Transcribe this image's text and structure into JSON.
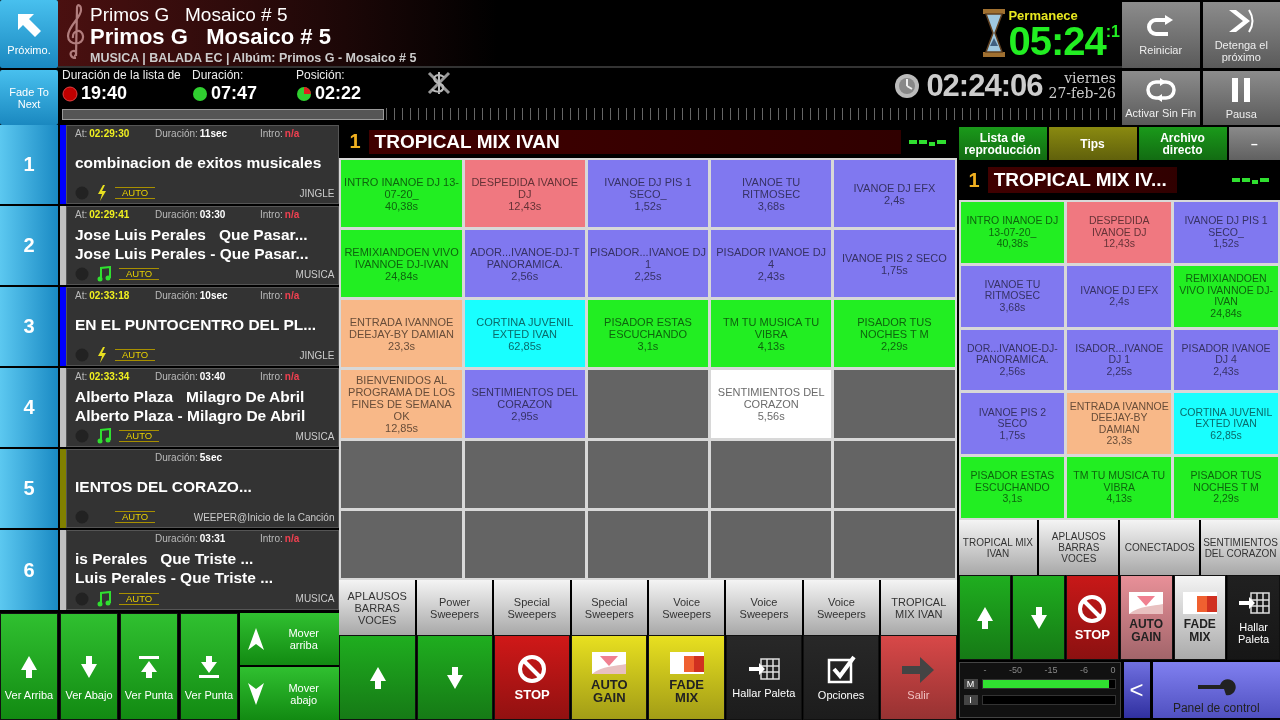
{
  "top": {
    "next_button": "Próximo.",
    "fade_button": "Fade To Next",
    "now_playing": {
      "title_small": "Primos G   Mosaico # 5",
      "title": "Primos G   Mosaico # 5",
      "info": "MUSICA | BALADA EC | Albúm: Primos G - Mosaico # 5"
    },
    "timers": [
      {
        "label": "Duración de la lista de",
        "value": "19:40",
        "kind": "list"
      },
      {
        "label": "Duración:",
        "value": "07:47",
        "kind": "track"
      },
      {
        "label": "Posición:",
        "value": "02:22",
        "kind": "position"
      }
    ],
    "remaining": {
      "label": "Permanece",
      "value": "05:24",
      "fraction": ":1"
    },
    "clock": {
      "time": "02:24:06",
      "day": "viernes",
      "date": "27-feb-26"
    },
    "controls": [
      {
        "kind": "restart",
        "label": "Reiniciar"
      },
      {
        "kind": "skip",
        "label": "Detenga el próximo"
      },
      {
        "kind": "loop",
        "label": "Activar Sin Fin"
      },
      {
        "kind": "pause",
        "label": "Pausa"
      }
    ]
  },
  "playlist": [
    {
      "number": "1",
      "at_label": "At:",
      "at": "02:29:30",
      "duration_label": "Duración:",
      "duration": "11sec",
      "intro_label": "Intro:",
      "intro": "n/a",
      "lines": [
        "combinacion de exitos musicales"
      ],
      "kind": "jingle",
      "mode": "AUTO",
      "type": "JINGLE",
      "color": "#0000ff"
    },
    {
      "number": "2",
      "at_label": "At:",
      "at": "02:29:41",
      "duration_label": "Duración:",
      "duration": "03:30",
      "intro_label": "Intro:",
      "intro": "n/a",
      "lines": [
        "Jose Luis Perales   Que Pasar...",
        "Jose Luis Perales - Que Pasar..."
      ],
      "kind": "music",
      "mode": "AUTO",
      "type": "MUSICA",
      "color": "#c0c0c0"
    },
    {
      "number": "3",
      "at_label": "At:",
      "at": "02:33:18",
      "duration_label": "Duración:",
      "duration": "10sec",
      "intro_label": "Intro:",
      "intro": "n/a",
      "lines": [
        "EN EL PUNTOCENTRO DEL PL..."
      ],
      "kind": "jingle",
      "mode": "AUTO",
      "type": "JINGLE",
      "color": "#0000ff"
    },
    {
      "number": "4",
      "at_label": "At:",
      "at": "02:33:34",
      "duration_label": "Duración:",
      "duration": "03:40",
      "intro_label": "Intro:",
      "intro": "n/a",
      "lines": [
        "Alberto Plaza   Milagro De Abril",
        "Alberto Plaza - Milagro De Abril"
      ],
      "kind": "music",
      "mode": "AUTO",
      "type": "MUSICA",
      "color": "#c0c0c0"
    },
    {
      "number": "5",
      "duration_label": "Duración:",
      "duration": "5sec",
      "lines": [
        "IENTOS DEL CORAZO..."
      ],
      "mode": "AUTO",
      "type": "WEEPER@Inicio de la Canción",
      "color": "#808000"
    },
    {
      "number": "6",
      "duration_label": "Duración:",
      "duration": "03:31",
      "intro_label": "Intro:",
      "intro": "n/a",
      "lines": [
        "is Perales   Que Triste ...",
        "Luis Perales - Que Triste ..."
      ],
      "kind": "music",
      "mode": "AUTO",
      "type": "MUSICA",
      "color": "#c0c0c0"
    }
  ],
  "center": {
    "page_number": "1",
    "title": "TROPICAL MIX IVAN",
    "cells": [
      {
        "name": "INTRO INANOE DJ 13-07-20_",
        "duration": "40,38s",
        "color": "#22ee22"
      },
      {
        "name": "DESPEDIDA IVANOE DJ",
        "duration": "12,43s",
        "color": "#f07880"
      },
      {
        "name": "IVANOE DJ PIS 1 SECO_",
        "duration": "1,52s",
        "color": "#8078f0"
      },
      {
        "name": "IVANOE TU RITMOSEC",
        "duration": "3,68s",
        "color": "#8078f0"
      },
      {
        "name": "IVANOE DJ EFX",
        "duration": "2,4s",
        "color": "#8078f0"
      },
      {
        "name": "REMIXIANDOEN VIVO IVANNOE DJ-IVAN",
        "duration": "24,84s",
        "color": "#22ee22"
      },
      {
        "name": "ADOR...IVANOE-DJ-T PANORAMICA.",
        "duration": "2,56s",
        "color": "#8078f0"
      },
      {
        "name": "PISADOR...IVANOE DJ  1",
        "duration": "2,25s",
        "color": "#8078f0"
      },
      {
        "name": "PISADOR IVANOE DJ 4",
        "duration": "2,43s",
        "color": "#8078f0"
      },
      {
        "name": "IVANOE PIS 2 SECO",
        "duration": "1,75s",
        "color": "#8078f0"
      },
      {
        "name": "ENTRADA IVANNOE DEEJAY-BY DAMIAN",
        "duration": "23,3s",
        "color": "#f8b888"
      },
      {
        "name": "CORTINA JUVENIL EXTED IVAN",
        "duration": "62,85s",
        "color": "#18ffff"
      },
      {
        "name": "PISADOR ESTAS ESCUCHANDO",
        "duration": "3,1s",
        "color": "#22ee22"
      },
      {
        "name": "TM TU MUSICA TU VIBRA",
        "duration": "4,13s",
        "color": "#22ee22"
      },
      {
        "name": "PISADOR TUS NOCHES T M",
        "duration": "2,29s",
        "color": "#22ee22"
      },
      {
        "name": "BIENVENIDOS AL PROGRAMA DE LOS FINES DE SEMANA OK",
        "duration": "12,85s",
        "color": "#f8b888"
      },
      {
        "name": "SENTIMIENTOS DEL CORAZON",
        "duration": "2,95s",
        "color": "#8078f0"
      },
      {
        "color": "#646464"
      },
      {
        "name": "SENTIMIENTOS DEL CORAZON",
        "duration": "5,56s",
        "color": "#ffffff"
      },
      {
        "color": "#646464"
      },
      {
        "color": "#646464"
      },
      {
        "color": "#646464"
      },
      {
        "color": "#646464"
      },
      {
        "color": "#646464"
      },
      {
        "color": "#646464"
      },
      {
        "color": "#646464"
      },
      {
        "color": "#646464"
      },
      {
        "color": "#646464"
      },
      {
        "color": "#646464"
      },
      {
        "color": "#646464"
      }
    ],
    "categories": [
      "APLAUSOS BARRAS VOCES",
      "Power Sweepers",
      "Special Sweepers",
      "Special Sweepers",
      "Voice Sweepers",
      "Voice Sweepers",
      "Voice Sweepers",
      "TROPICAL MIX IVAN"
    ]
  },
  "side": {
    "tabs": [
      {
        "label": "Lista de reproducción",
        "color": "#1a9a1a"
      },
      {
        "label": "Tips",
        "color": "#8a8a10"
      },
      {
        "label": "Archivo directo",
        "color": "#1a9a1a"
      },
      {
        "label": "–",
        "color": "#8a8a8a"
      }
    ],
    "page_number": "1",
    "title": "TROPICAL MIX IV...",
    "cells": [
      {
        "name": "INTRO INANOE DJ 13-07-20_",
        "duration": "40,38s",
        "color": "#22ee22"
      },
      {
        "name": "DESPEDIDA IVANOE DJ",
        "duration": "12,43s",
        "color": "#f07880"
      },
      {
        "name": "IVANOE DJ PIS 1 SECO_",
        "duration": "1,52s",
        "color": "#8078f0"
      },
      {
        "name": "IVANOE TU RITMOSEC",
        "duration": "3,68s",
        "color": "#8078f0"
      },
      {
        "name": "IVANOE DJ EFX",
        "duration": "2,4s",
        "color": "#8078f0"
      },
      {
        "name": "REMIXIANDOEN VIVO IVANNOE DJ-IVAN",
        "duration": "24,84s",
        "color": "#22ee22"
      },
      {
        "name": "DOR...IVANOE-DJ- PANORAMICA.",
        "duration": "2,56s",
        "color": "#8078f0"
      },
      {
        "name": "ISADOR...IVANOE DJ  1",
        "duration": "2,25s",
        "color": "#8078f0"
      },
      {
        "name": "PISADOR IVANOE DJ 4",
        "duration": "2,43s",
        "color": "#8078f0"
      },
      {
        "name": "IVANOE PIS 2 SECO",
        "duration": "1,75s",
        "color": "#8078f0"
      },
      {
        "name": "ENTRADA IVANNOE DEEJAY-BY DAMIAN",
        "duration": "23,3s",
        "color": "#f8b888"
      },
      {
        "name": "CORTINA JUVENIL EXTED IVAN",
        "duration": "62,85s",
        "color": "#18ffff"
      },
      {
        "name": "PISADOR ESTAS ESCUCHANDO",
        "duration": "3,1s",
        "color": "#22ee22"
      },
      {
        "name": "TM TU MUSICA TU VIBRA",
        "duration": "4,13s",
        "color": "#22ee22"
      },
      {
        "name": "PISADOR TUS NOCHES T M",
        "duration": "2,29s",
        "color": "#22ee22"
      }
    ],
    "categories": [
      "TROPICAL MIX IVAN",
      "APLAUSOS BARRAS VOCES",
      "CONECTADOS",
      "SENTIMIENTOS DEL CORAZON"
    ],
    "buttons": [
      {
        "kind": "up",
        "color": "#1fae1f"
      },
      {
        "kind": "down",
        "color": "#1fae1f"
      },
      {
        "kind": "stop",
        "label": "STOP",
        "color": "#c81818"
      },
      {
        "kind": "autogain",
        "label": "AUTO GAIN",
        "color": "#e89098"
      },
      {
        "kind": "fademix",
        "label": "FADE MIX",
        "color": "#f4f4f4"
      },
      {
        "kind": "palette",
        "label": "Hallar Paleta",
        "color": "#202020"
      }
    ],
    "meter": {
      "scale": [
        "-",
        "-50",
        "-15",
        "-6",
        "0"
      ],
      "channels": [
        {
          "label": "M",
          "level": 0.96
        },
        {
          "label": "I"
        }
      ]
    },
    "back_button": "<",
    "panel_button": "Panel de control"
  },
  "bottom_left": [
    {
      "kind": "up",
      "label": "Ver Arriba"
    },
    {
      "kind": "down",
      "label": "Ver Abajo"
    },
    {
      "kind": "top",
      "label": "Ver Punta"
    },
    {
      "kind": "bottom",
      "label": "Ver Punta"
    }
  ],
  "move_buttons": [
    {
      "kind": "up",
      "label": "Mover arriba"
    },
    {
      "kind": "down",
      "label": "Mover abajo"
    }
  ],
  "bottom_center": [
    {
      "kind": "up",
      "color": "#1fae1f"
    },
    {
      "kind": "down",
      "color": "#1fae1f"
    },
    {
      "kind": "stop",
      "label": "STOP",
      "color": "#d01818"
    },
    {
      "kind": "autogain",
      "label": "AUTO GAIN",
      "color": "#e8e020"
    },
    {
      "kind": "fademix",
      "label": "FADE MIX",
      "color": "#e8e020"
    },
    {
      "kind": "palette",
      "label": "Hallar Paleta",
      "color": "#282828"
    },
    {
      "kind": "options",
      "label": "Opciones",
      "color": "#282828"
    },
    {
      "kind": "exit",
      "label": "Salir",
      "color": "#d84848"
    }
  ]
}
